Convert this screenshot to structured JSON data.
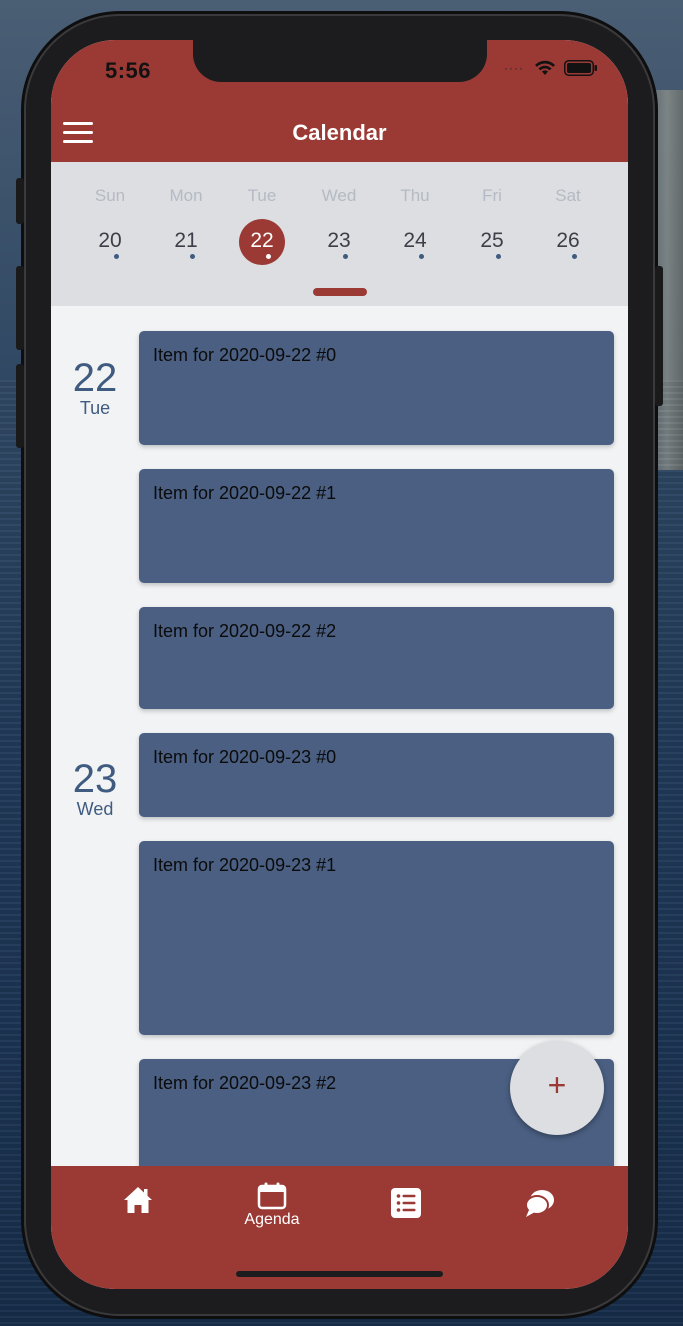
{
  "status": {
    "time": "5:56",
    "signal_dots": "····"
  },
  "header": {
    "title": "Calendar"
  },
  "week": {
    "days": [
      {
        "name": "Sun",
        "num": "20"
      },
      {
        "name": "Mon",
        "num": "21"
      },
      {
        "name": "Tue",
        "num": "22"
      },
      {
        "name": "Wed",
        "num": "23"
      },
      {
        "name": "Thu",
        "num": "24"
      },
      {
        "name": "Fri",
        "num": "25"
      },
      {
        "name": "Sat",
        "num": "26"
      }
    ],
    "selected_index": 2
  },
  "agenda": {
    "groups": [
      {
        "day_num": "22",
        "day_name": "Tue",
        "items": [
          "Item for 2020-09-22 #0",
          "Item for 2020-09-22 #1",
          "Item for 2020-09-22 #2"
        ]
      },
      {
        "day_num": "23",
        "day_name": "Wed",
        "items": [
          "Item for 2020-09-23 #0",
          "Item for 2020-09-23 #1",
          "Item for 2020-09-23 #2"
        ]
      }
    ]
  },
  "fab": {
    "label": "+"
  },
  "tabs": [
    {
      "icon": "home-icon",
      "label": ""
    },
    {
      "icon": "calendar-icon",
      "label": "Agenda"
    },
    {
      "icon": "list-icon",
      "label": ""
    },
    {
      "icon": "chat-icon",
      "label": ""
    }
  ],
  "colors": {
    "primary": "#9b3a35",
    "item": "#4a5f82",
    "accent_text": "#3f5b80",
    "strip": "#dcdee2"
  }
}
